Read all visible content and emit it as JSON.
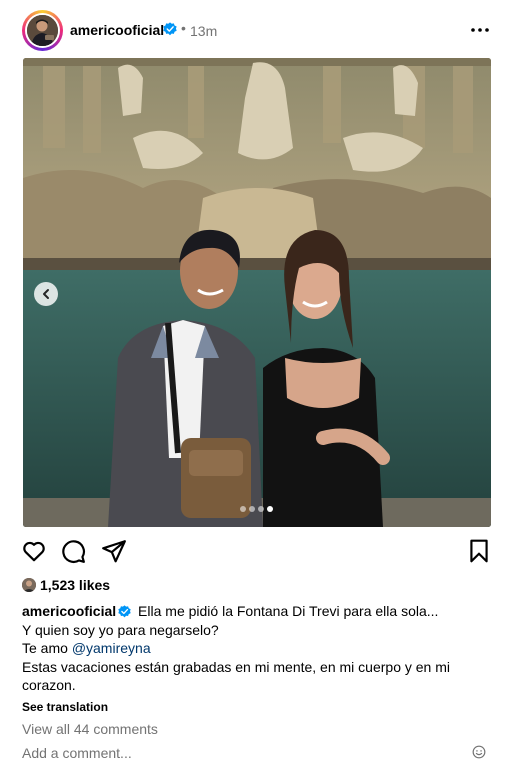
{
  "post": {
    "username": "americooficial",
    "separator": "•",
    "time_ago": "13m",
    "carousel": {
      "slide_count": 4,
      "active_index": 3
    }
  },
  "actions": {
    "like_icon": "heart-icon",
    "comment_icon": "comment-icon",
    "share_icon": "send-icon",
    "save_icon": "bookmark-icon"
  },
  "likes": {
    "count_text": "1,523 likes"
  },
  "caption": {
    "username": "americooficial",
    "line1": "Ella me pidió la Fontana Di Trevi para ella sola...",
    "line2": "Y quien soy yo para negarselo?",
    "line3_prefix": "Te amo ",
    "mention": "@yamireyna",
    "line4": "Estas vacaciones están grabadas en mi mente, en mi cuerpo y en mi corazon."
  },
  "see_translation": "See translation",
  "view_comments": "View all 44 comments",
  "comment_input": {
    "placeholder": "Add a comment..."
  },
  "colors": {
    "verified": "#0095f6",
    "link": "#00376b",
    "muted": "#737373"
  }
}
